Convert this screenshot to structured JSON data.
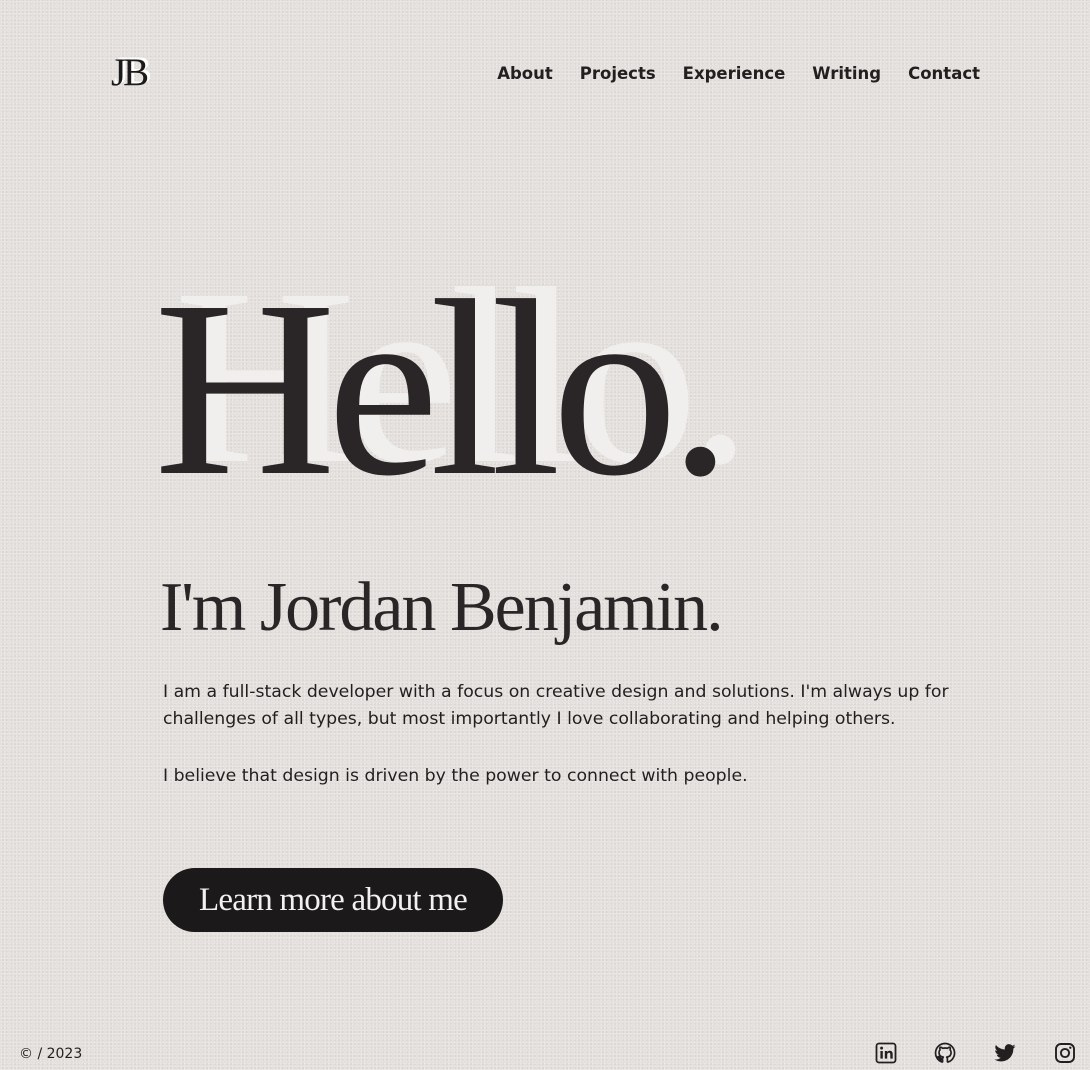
{
  "header": {
    "logo_text": "JB",
    "nav": [
      {
        "label": "About"
      },
      {
        "label": "Projects"
      },
      {
        "label": "Experience"
      },
      {
        "label": "Writing"
      },
      {
        "label": "Contact"
      }
    ]
  },
  "hero": {
    "title": "Hello.",
    "subtitle": "I'm Jordan Benjamin.",
    "paragraphs": [
      "I am a full-stack developer with a focus on creative design and solutions. I'm always up for challenges of all types, but most importantly I love collaborating and helping others.",
      "I believe that design is driven by the power to connect with people."
    ],
    "cta_label": "Learn more about me"
  },
  "footer": {
    "copyright": "© / 2023",
    "social": [
      {
        "icon": "linkedin-icon"
      },
      {
        "icon": "github-icon"
      },
      {
        "icon": "twitter-icon"
      },
      {
        "icon": "instagram-icon"
      }
    ]
  },
  "colors": {
    "background": "#e4e0dd",
    "text": "#231f20",
    "button_bg": "#1c191a",
    "button_text": "#f3f1f0",
    "title_shadow": "#f1efee"
  }
}
